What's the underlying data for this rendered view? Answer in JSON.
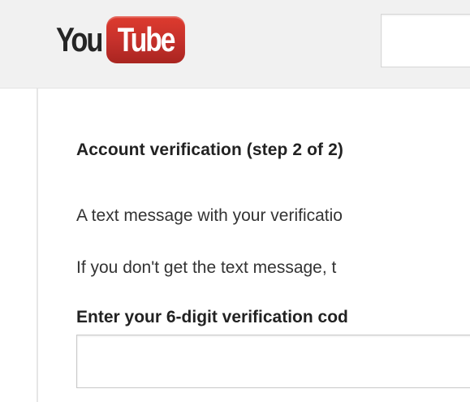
{
  "header": {
    "logo": {
      "you_text": "You",
      "tube_text": "Tube",
      "tube_color": "#c4302b"
    },
    "search": {
      "value": "",
      "placeholder": ""
    }
  },
  "main": {
    "heading": "Account verification (step 2 of 2)",
    "message_line_1": "A text message with your verificatio",
    "message_line_2": "If you don't get the text message, t",
    "code_label": "Enter your 6-digit verification cod",
    "code_input": {
      "value": "",
      "placeholder": ""
    }
  }
}
